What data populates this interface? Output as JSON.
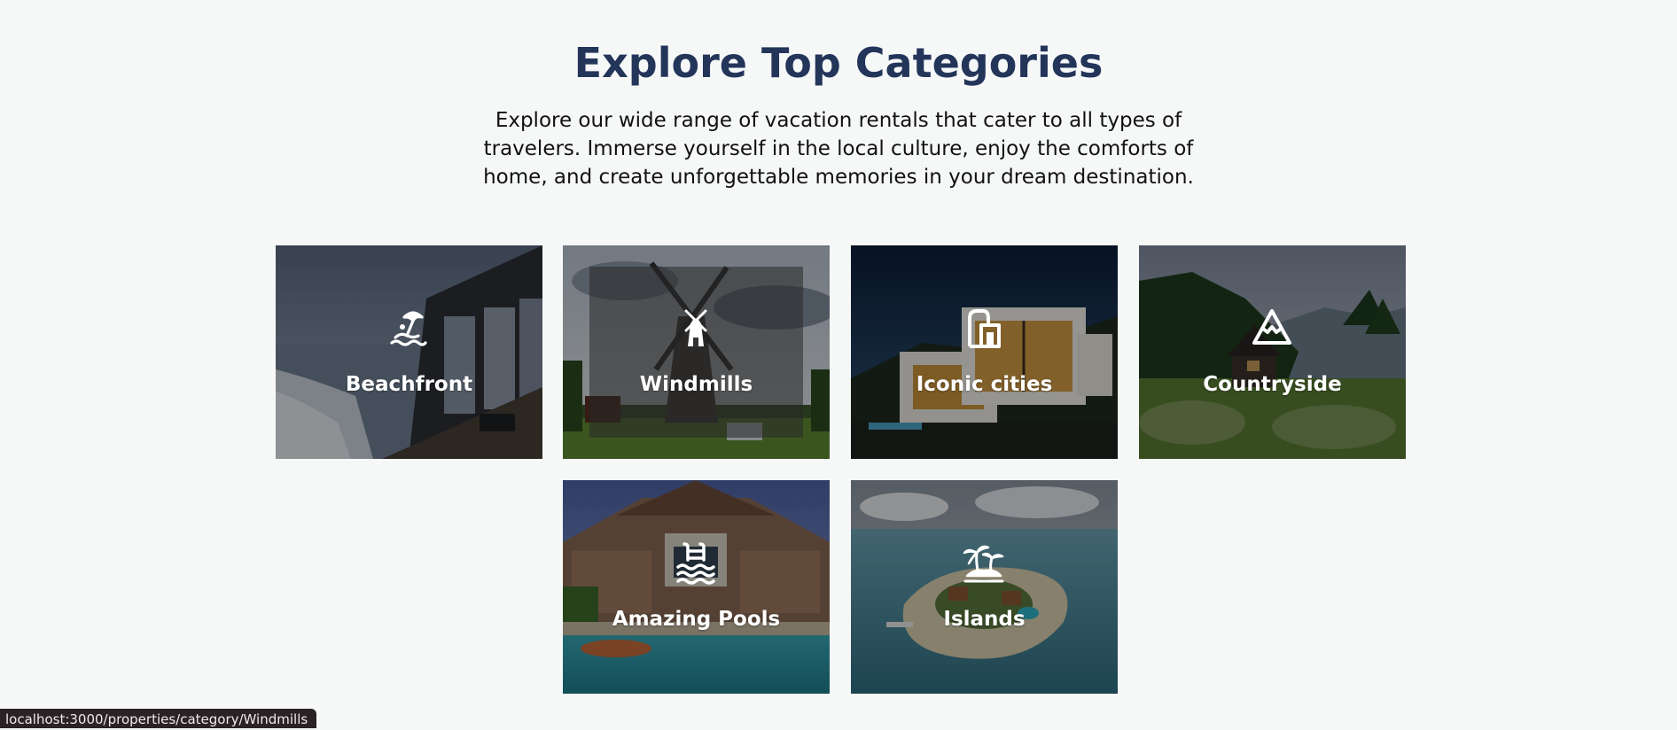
{
  "header": {
    "title": "Explore Top Categories",
    "subtitle": "Explore our wide range of vacation rentals that cater to all types of travelers. Immerse yourself in the local culture, enjoy the comforts of home, and create unforgettable memories in your dream destination."
  },
  "categories": [
    {
      "label": "Beachfront",
      "icon": "beach-umbrella-icon"
    },
    {
      "label": "Windmills",
      "icon": "windmill-icon"
    },
    {
      "label": "Iconic cities",
      "icon": "city-building-icon"
    },
    {
      "label": "Countryside",
      "icon": "mountain-icon"
    },
    {
      "label": "Amazing Pools",
      "icon": "pool-ladder-icon"
    },
    {
      "label": "Islands",
      "icon": "palm-island-icon"
    }
  ],
  "status_bar": {
    "url": "localhost:3000/properties/category/Windmills"
  },
  "colors": {
    "title": "#24355a",
    "background": "#f6f8f8",
    "status_bar": "#2a2224"
  }
}
